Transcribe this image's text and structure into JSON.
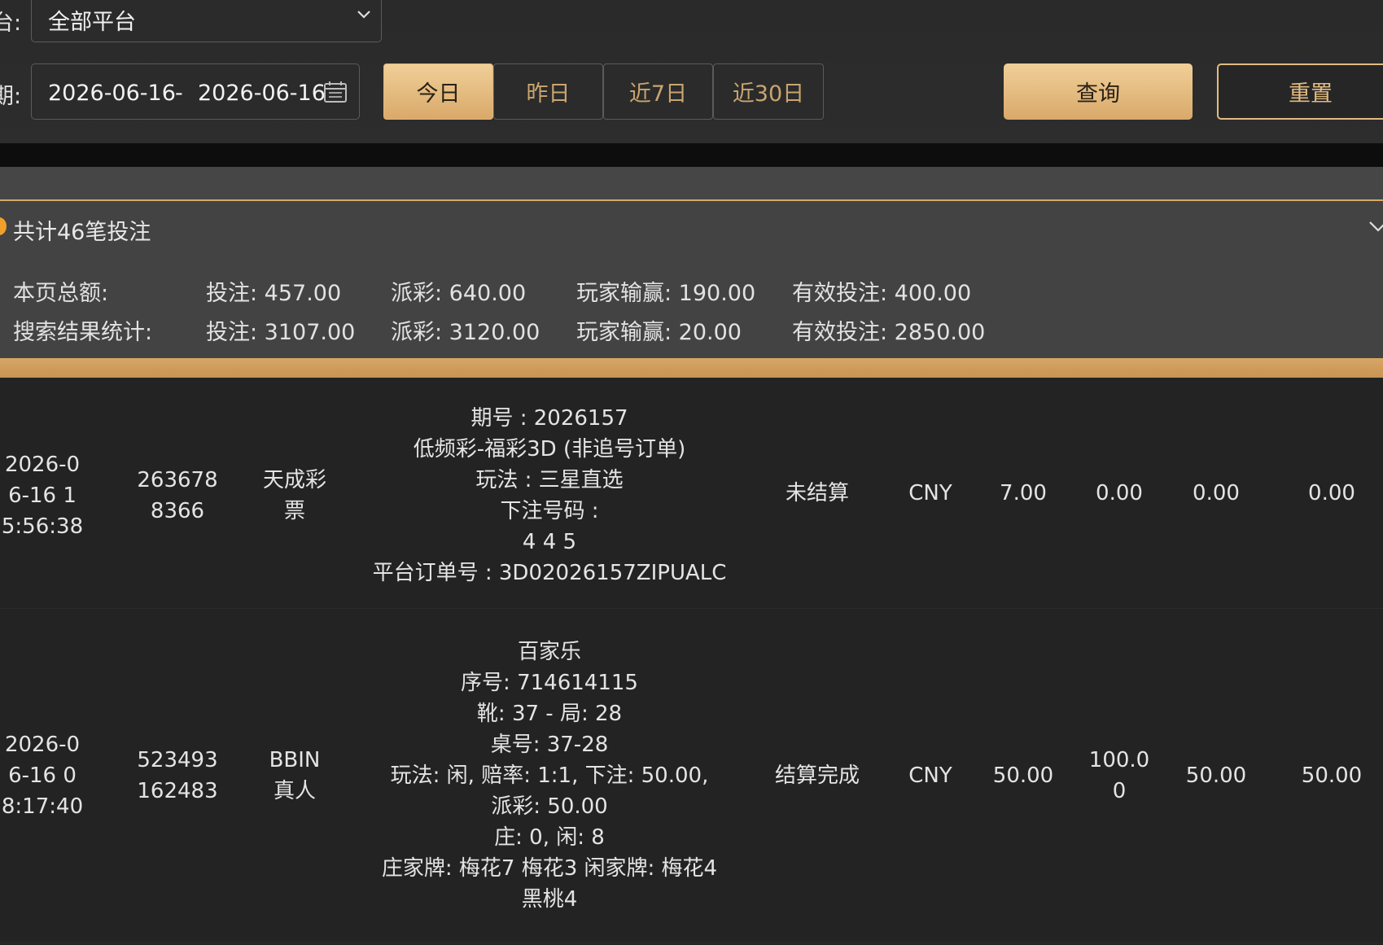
{
  "filters": {
    "platform_label": "台:",
    "platform_value": "全部平台",
    "date_label": "期:",
    "date_start": "2026-06-16",
    "date_sep": "-",
    "date_end": "2026-06-16",
    "quick": [
      {
        "label": "今日",
        "active": true
      },
      {
        "label": "昨日",
        "active": false
      },
      {
        "label": "近7日",
        "active": false
      },
      {
        "label": "近30日",
        "active": false
      }
    ],
    "query_label": "查询",
    "reset_label": "重置"
  },
  "summary": {
    "count_text": "共计46笔投注",
    "page": {
      "label": "本页总额:",
      "bet": "投注: 457.00",
      "payout": "派彩: 640.00",
      "winloss": "玩家输赢: 190.00",
      "valid": "有效投注: 400.00"
    },
    "search": {
      "label": "搜索结果统计:",
      "bet": "投注: 3107.00",
      "payout": "派彩: 3120.00",
      "winloss": "玩家输赢: 20.00",
      "valid": "有效投注: 2850.00"
    }
  },
  "rows": [
    {
      "time": "2026-06-16 15:56:38",
      "order": "2636788366",
      "platform": "天成彩票",
      "details": [
        "期号 : 2026157",
        "低频彩-福彩3D (非追号订单)",
        "玩法 : 三星直选",
        "下注号码 :",
        "4 4 5",
        "平台订单号 : 3D02026157ZIPUALC"
      ],
      "status": "未结算",
      "currency": "CNY",
      "bet": "7.00",
      "payout": "0.00",
      "valid": "0.00",
      "winloss": "0.00"
    },
    {
      "time": "2026-06-16 08:17:40",
      "order": "523493162483",
      "platform": "BBIN真人",
      "details": [
        "百家乐",
        "序号: 714614115",
        "靴: 37 - 局: 28",
        "桌号: 37-28",
        "玩法: 闲, 赔率: 1:1, 下注: 50.00, 派彩: 50.00",
        "庄: 0, 闲: 8",
        "庄家牌: 梅花7 梅花3 闲家牌: 梅花4 黑桃4"
      ],
      "status": "结算完成",
      "currency": "CNY",
      "bet": "50.00",
      "payout": "100.00",
      "valid": "50.00",
      "winloss": "50.00"
    }
  ],
  "colors": {
    "accent": "#d9a96a",
    "background": "#232323",
    "summary_bg": "#434343",
    "indicator": "#f0a02a"
  }
}
